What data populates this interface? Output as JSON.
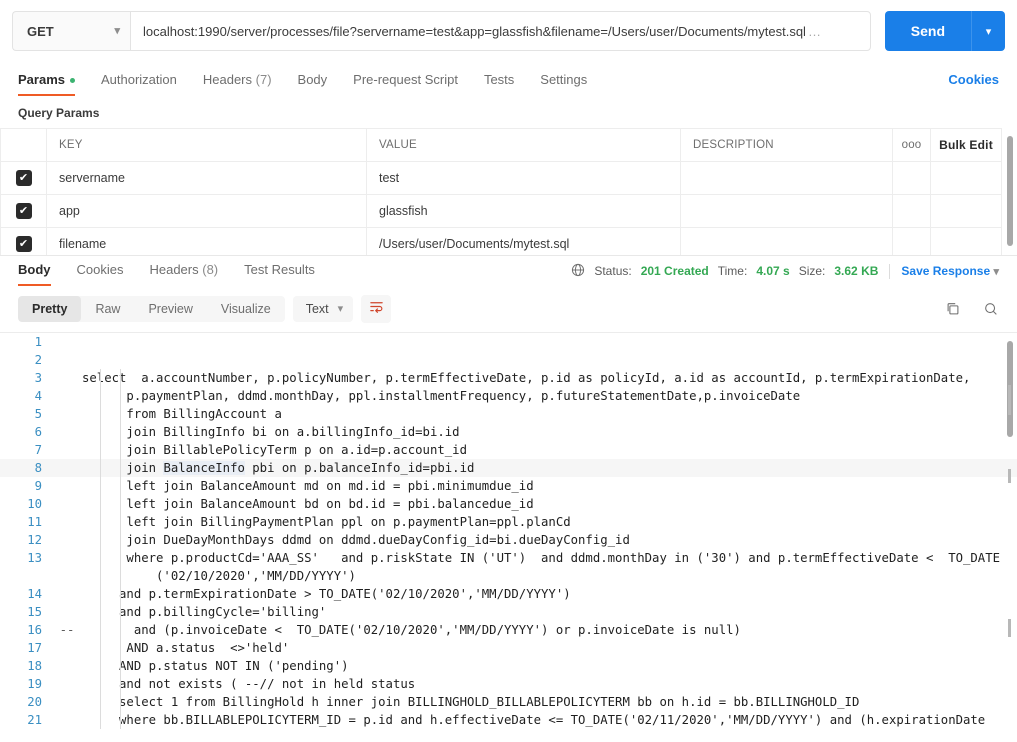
{
  "request": {
    "method": "GET",
    "method_chevron_icon": "chevron-down-icon",
    "url": "localhost:1990/server/processes/file?servername=test&app=glassfish&filename=/Users/user/Documents/mytest.sql",
    "url_truncation": "…",
    "send_label": "Send",
    "send_caret_icon": "chevron-down-icon"
  },
  "request_tabs": {
    "items": [
      {
        "label": "Params",
        "badge_dot": true,
        "active": true
      },
      {
        "label": "Authorization",
        "active": false
      },
      {
        "label": "Headers",
        "count": "(7)",
        "active": false
      },
      {
        "label": "Body",
        "active": false
      },
      {
        "label": "Pre-request Script",
        "active": false
      },
      {
        "label": "Tests",
        "active": false
      },
      {
        "label": "Settings",
        "active": false
      }
    ],
    "cookies_label": "Cookies"
  },
  "query_params": {
    "section_title": "Query Params",
    "columns": [
      "KEY",
      "VALUE",
      "DESCRIPTION"
    ],
    "options_icon": "ooo",
    "bulk_edit_label": "Bulk Edit",
    "checkbox_glyph": "✔",
    "rows": [
      {
        "checked": true,
        "key": "servername",
        "value": "test",
        "description": ""
      },
      {
        "checked": true,
        "key": "app",
        "value": "glassfish",
        "description": ""
      },
      {
        "checked": true,
        "key": "filename",
        "value": "/Users/user/Documents/mytest.sql",
        "description": ""
      }
    ]
  },
  "response": {
    "tabs": [
      {
        "label": "Body",
        "active": true
      },
      {
        "label": "Cookies",
        "active": false
      },
      {
        "label": "Headers",
        "count": "(8)",
        "active": false
      },
      {
        "label": "Test Results",
        "active": false
      }
    ],
    "globe_icon": "globe-icon",
    "status_label": "Status:",
    "status_value": "201 Created",
    "time_label": "Time:",
    "time_value": "4.07 s",
    "size_label": "Size:",
    "size_value": "3.62 KB",
    "save_response_label": "Save Response",
    "save_response_caret_icon": "chevron-down-icon",
    "status_color": "#34a853",
    "link_color": "#1a7fe8"
  },
  "viewer": {
    "modes": [
      {
        "label": "Pretty",
        "active": true
      },
      {
        "label": "Raw",
        "active": false
      },
      {
        "label": "Preview",
        "active": false
      },
      {
        "label": "Visualize",
        "active": false
      }
    ],
    "format_label": "Text",
    "format_caret_icon": "chevron-down-icon",
    "wrap_icon": "word-wrap-icon",
    "wrap_icon_color": "#d0452b",
    "copy_icon": "copy-icon",
    "search_icon": "search-icon"
  },
  "code": {
    "highlighted_line": 8,
    "selection_text": "BalanceInfo",
    "lines": [
      {
        "n": 1,
        "fold": "",
        "indent": 0,
        "text": ""
      },
      {
        "n": 2,
        "fold": "",
        "indent": 0,
        "text": ""
      },
      {
        "n": 3,
        "fold": "",
        "indent": 0,
        "text": "select  a.accountNumber, p.policyNumber, p.termEffectiveDate, p.id as policyId, a.id as accountId, p.termExpirationDate,"
      },
      {
        "n": 4,
        "fold": "",
        "indent": 2,
        "text": "      p.paymentPlan, ddmd.monthDay, ppl.installmentFrequency, p.futureStatementDate,p.invoiceDate"
      },
      {
        "n": 5,
        "fold": "",
        "indent": 2,
        "text": "      from BillingAccount a"
      },
      {
        "n": 6,
        "fold": "",
        "indent": 2,
        "text": "      join BillingInfo bi on a.billingInfo_id=bi.id"
      },
      {
        "n": 7,
        "fold": "",
        "indent": 2,
        "text": "      join BillablePolicyTerm p on a.id=p.account_id"
      },
      {
        "n": 8,
        "fold": "",
        "indent": 2,
        "text": "      join BalanceInfo pbi on p.balanceInfo_id=pbi.id"
      },
      {
        "n": 9,
        "fold": "",
        "indent": 2,
        "text": "      left join BalanceAmount md on md.id = pbi.minimumdue_id"
      },
      {
        "n": 10,
        "fold": "",
        "indent": 2,
        "text": "      left join BalanceAmount bd on bd.id = pbi.balancedue_id"
      },
      {
        "n": 11,
        "fold": "",
        "indent": 2,
        "text": "      left join BillingPaymentPlan ppl on p.paymentPlan=ppl.planCd"
      },
      {
        "n": 12,
        "fold": "",
        "indent": 2,
        "text": "      join DueDayMonthDays ddmd on ddmd.dueDayConfig_id=bi.dueDayConfig_id"
      },
      {
        "n": 13,
        "fold": "",
        "indent": 2,
        "text": "      where p.productCd='AAA_SS'   and p.riskState IN ('UT')  and ddmd.monthDay in ('30') and p.termEffectiveDate <  TO_DATE"
      },
      {
        "n": "",
        "fold": "",
        "indent": 2,
        "text": "          ('02/10/2020','MM/DD/YYYY')"
      },
      {
        "n": 14,
        "fold": "",
        "indent": 1,
        "text": "     and p.termExpirationDate > TO_DATE('02/10/2020','MM/DD/YYYY')"
      },
      {
        "n": 15,
        "fold": "",
        "indent": 1,
        "text": "     and p.billingCycle='billing'"
      },
      {
        "n": 16,
        "fold": "--",
        "indent": 1,
        "text": "       and (p.invoiceDate <  TO_DATE('02/10/2020','MM/DD/YYYY') or p.invoiceDate is null)"
      },
      {
        "n": 17,
        "fold": "",
        "indent": 2,
        "text": "      AND a.status  <>'held'"
      },
      {
        "n": 18,
        "fold": "",
        "indent": 1,
        "text": "     AND p.status NOT IN ('pending')"
      },
      {
        "n": 19,
        "fold": "",
        "indent": 1,
        "text": "     and not exists ( --// not in held status"
      },
      {
        "n": 20,
        "fold": "",
        "indent": 1,
        "text": "     select 1 from BillingHold h inner join BILLINGHOLD_BILLABLEPOLICYTERM bb on h.id = bb.BILLINGHOLD_ID"
      },
      {
        "n": 21,
        "fold": "",
        "indent": 1,
        "text": "     where bb.BILLABLEPOLICYTERM_ID = p.id and h.effectiveDate <= TO_DATE('02/11/2020','MM/DD/YYYY') and (h.expirationDate"
      }
    ]
  }
}
